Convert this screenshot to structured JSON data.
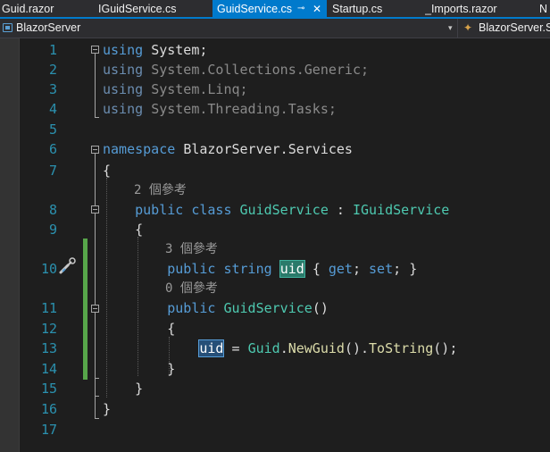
{
  "tabs": [
    {
      "label": "Guid.razor",
      "active": false
    },
    {
      "label": "IGuidService.cs",
      "active": false
    },
    {
      "label": "GuidService.cs",
      "active": true,
      "pin": "⊸",
      "close": "✕"
    },
    {
      "label": "Startup.cs",
      "active": false
    },
    {
      "label": "_Imports.razor",
      "active": false
    },
    {
      "label": "N",
      "active": false
    }
  ],
  "navbar": {
    "project": "BlazorServer",
    "type": "BlazorServer.S",
    "project_icon": "project-icon",
    "type_icon": "class-icon"
  },
  "editor": {
    "line_numbers": [
      "1",
      "2",
      "3",
      "4",
      "5",
      "6",
      "7",
      "8",
      "9",
      "10",
      "11",
      "12",
      "13",
      "14",
      "15",
      "16",
      "17"
    ],
    "references": {
      "class": "2 個參考",
      "property": "3 個參考",
      "constructor": "0 個參考"
    },
    "tokens": {
      "using": "using",
      "ns1": "System",
      "ns2": "System.Collections.Generic",
      "ns3": "System.Linq",
      "ns4": "System.Threading.Tasks",
      "semi": ";",
      "namespace_kw": "namespace",
      "namespace_name": "BlazorServer.Services",
      "open_brace": "{",
      "close_brace": "}",
      "public_kw": "public",
      "class_kw": "class",
      "class_name": "GuidService",
      "colon": " : ",
      "interface_name": "IGuidService",
      "string_kw": "string",
      "prop_name": "uid",
      "get_kw": "get",
      "set_kw": "set",
      "ctor_name": "GuidService",
      "parens": "()",
      "assign_target": "uid",
      "assign_op": " = ",
      "guid_type": "Guid",
      "dot": ".",
      "newguid": "NewGuid",
      "tostring": "ToString",
      "call_end": "();"
    },
    "colors": {
      "keyword": "#569cd6",
      "type": "#4ec9b0",
      "method": "#dcdcaa",
      "line_number": "#2b91af",
      "change_bar": "#57a64a",
      "accent": "#007acc"
    }
  }
}
